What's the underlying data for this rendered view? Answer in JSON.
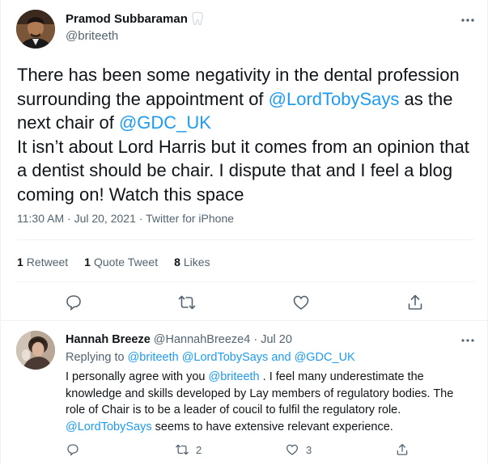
{
  "tweet": {
    "author_name": "Pramod Subbaraman",
    "author_handle": "@briteeth",
    "text_parts": {
      "p1": "There has been some negativity in the dental profession surrounding the appointment of ",
      "mention1": "@LordTobySays",
      "p2": " as the next chair of ",
      "mention2": "@GDC_UK",
      "p3": "It isn’t about Lord Harris but it comes from an opinion that a dentist should be chair. I dispute that and I feel a blog coming on! Watch this space"
    },
    "time": "11:30 AM",
    "date": "Jul 20, 2021",
    "separator": "·",
    "source": "Twitter for iPhone",
    "stats": {
      "retweets_count": "1",
      "retweets_label": "Retweet",
      "quotes_count": "1",
      "quotes_label": "Quote Tweet",
      "likes_count": "8",
      "likes_label": "Likes"
    },
    "icons": [
      "tooth-icon",
      "more-icon",
      "reply-icon",
      "retweet-icon",
      "like-icon",
      "share-icon"
    ]
  },
  "reply": {
    "author_name": "Hannah Breeze",
    "author_handle": "@HannahBreeze4",
    "date": "Jul 20",
    "separator": "·",
    "replying_label": "Replying to ",
    "replying_handles": [
      "@briteeth",
      "@LordTobySays"
    ],
    "replying_and": " and ",
    "replying_last": "@GDC_UK",
    "text_parts": {
      "p1": "I personally agree with you ",
      "mention1": "@briteeth",
      "p2": " . I feel many underestimate the knowledge and skills developed by Lay members of regulatory bodies. The role of Chair is to be a leader of coucil to fulfil the regulatory role. ",
      "mention2": "@LordTobySays",
      "p3": " seems to have extensive relevant experience."
    },
    "retweet_count": "2",
    "like_count": "3"
  },
  "colors": {
    "link": "#1d9bf0",
    "text": "#0f1419",
    "secondary": "#536471",
    "divider": "#eff3f4"
  }
}
